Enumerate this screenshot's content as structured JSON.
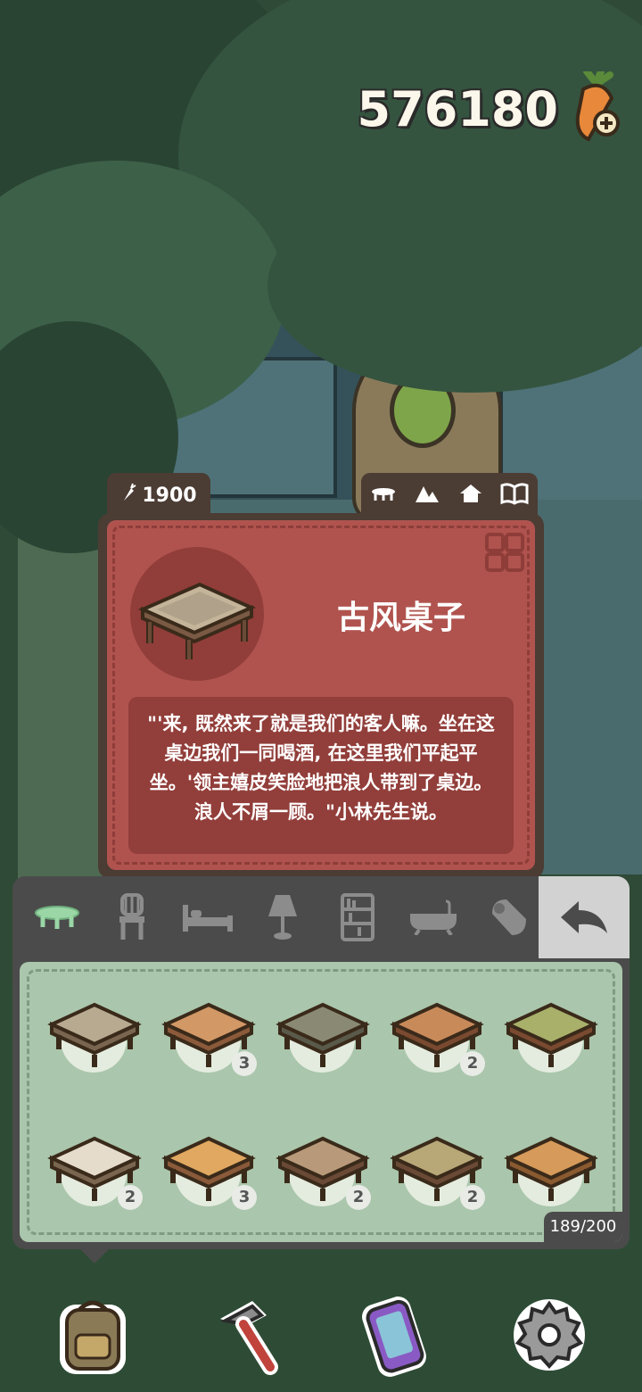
{
  "currency": {
    "amount": "576180",
    "icon": "carrot-plus-icon"
  },
  "item_card": {
    "price": "1900",
    "price_icon": "carrot-icon",
    "category_icons": [
      "table-icon",
      "mountain-icon",
      "house-icon",
      "book-icon"
    ],
    "name": "古风桌子",
    "description": "\"'来, 既然来了就是我们的客人嘛。坐在这桌边我们一同喝酒, 在这里我们平起平坐。'领主嬉皮笑脸地把浪人带到了桌边。浪人不屑一顾。\"小林先生说。"
  },
  "furniture_tabs": [
    {
      "name": "table",
      "icon": "table-icon",
      "active": true
    },
    {
      "name": "chair",
      "icon": "chair-icon",
      "active": false
    },
    {
      "name": "bed",
      "icon": "bed-icon",
      "active": false
    },
    {
      "name": "lamp",
      "icon": "lamp-icon",
      "active": false
    },
    {
      "name": "shelf",
      "icon": "shelf-icon",
      "active": false
    },
    {
      "name": "bathtub",
      "icon": "bathtub-icon",
      "active": false
    },
    {
      "name": "rug",
      "icon": "rug-icon",
      "active": false
    }
  ],
  "back_button_icon": "back-arrow-icon",
  "inventory": {
    "items": [
      {
        "name": "stone-table",
        "count": ""
      },
      {
        "name": "plank-table",
        "count": "3"
      },
      {
        "name": "mossy-table",
        "count": ""
      },
      {
        "name": "wooden-block-table",
        "count": "2"
      },
      {
        "name": "green-top-table",
        "count": ""
      },
      {
        "name": "marble-table",
        "count": "2"
      },
      {
        "name": "folding-table",
        "count": "3"
      },
      {
        "name": "ancient-style-table",
        "count": "2"
      },
      {
        "name": "glass-top-table",
        "count": "2"
      },
      {
        "name": "log-table",
        "count": ""
      }
    ],
    "capacity": "189/200"
  },
  "toolbar": [
    {
      "name": "backpack",
      "icon": "backpack-icon"
    },
    {
      "name": "build",
      "icon": "hammer-icon"
    },
    {
      "name": "phone",
      "icon": "phone-icon"
    },
    {
      "name": "settings",
      "icon": "gear-icon"
    }
  ],
  "colors": {
    "card_red": "#b0534e",
    "panel_gray": "#4b4b4b",
    "grid_green": "#aac6ac",
    "active_tab": "#9ad6a6"
  }
}
